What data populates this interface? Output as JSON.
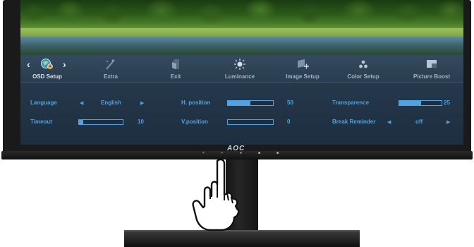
{
  "menu": {
    "items": [
      {
        "label": "OSD Setup",
        "icon": "osd-setup-icon",
        "active": true
      },
      {
        "label": "Extra",
        "icon": "extra-icon"
      },
      {
        "label": "Exit",
        "icon": "exit-icon"
      },
      {
        "label": "Luminance",
        "icon": "luminance-icon"
      },
      {
        "label": "Image Setup",
        "icon": "image-setup-icon"
      },
      {
        "label": "Color Setup",
        "icon": "color-setup-icon"
      },
      {
        "label": "Picture Boost",
        "icon": "picture-boost-icon"
      }
    ],
    "nav_left": "‹",
    "nav_right": "›"
  },
  "settings": {
    "language": {
      "label": "Language",
      "value": "English"
    },
    "timeout": {
      "label": "Timeout",
      "value": "10",
      "level": 10
    },
    "h_position": {
      "label": "H. position",
      "value": "50",
      "level": 50
    },
    "v_position": {
      "label": "V.position",
      "value": "0",
      "level": 0
    },
    "transparence": {
      "label": "Transparence",
      "value": "25",
      "level": 25
    },
    "break_reminder": {
      "label": "Break Reminder",
      "value": "off"
    }
  },
  "bezel": {
    "logo": "AOC",
    "buttons": [
      "<",
      ">",
      "●",
      "■",
      "■"
    ]
  },
  "colors": {
    "accent": "#4fa3e0",
    "osd_bg": "#1f3346"
  }
}
